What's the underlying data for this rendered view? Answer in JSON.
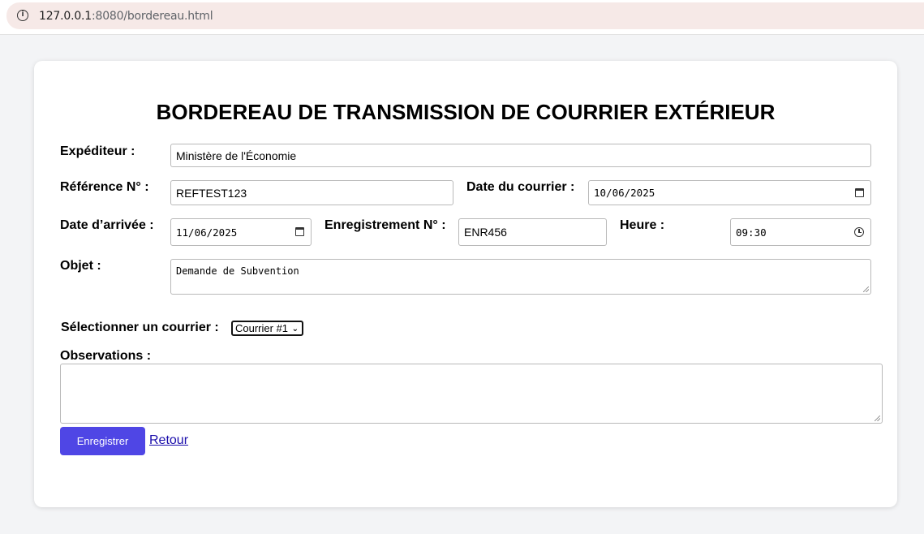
{
  "browser": {
    "url_host": "127.0.0.1",
    "url_rest": ":8080/bordereau.html"
  },
  "form": {
    "title": "BORDEREAU DE TRANSMISSION DE COURRIER EXTÉRIEUR",
    "expediteur_label": "Expéditeur :",
    "expediteur_value": "Ministère de l'Économie",
    "reference_label": "Référence N° :",
    "reference_value": "REFTEST123",
    "date_courrier_label": "Date du courrier :",
    "date_courrier_value": "10/06/2025",
    "date_arrivee_label": "Date d’arrivée :",
    "date_arrivee_value": "11/06/2025",
    "enregistrement_label": "Enregistrement N° :",
    "enregistrement_value": "ENR456",
    "heure_label": "Heure :",
    "heure_value": "09:30",
    "objet_label": "Objet :",
    "objet_value": "Demande de Subvention",
    "select_label": "Sélectionner un courrier :",
    "select_value": "Courrier #1",
    "observations_label": "Observations :",
    "observations_value": "",
    "save_label": "Enregistrer",
    "back_label": "Retour"
  },
  "colors": {
    "accent": "#4f46e5",
    "link": "#1a0dab",
    "page_bg": "#f3f4f6"
  }
}
